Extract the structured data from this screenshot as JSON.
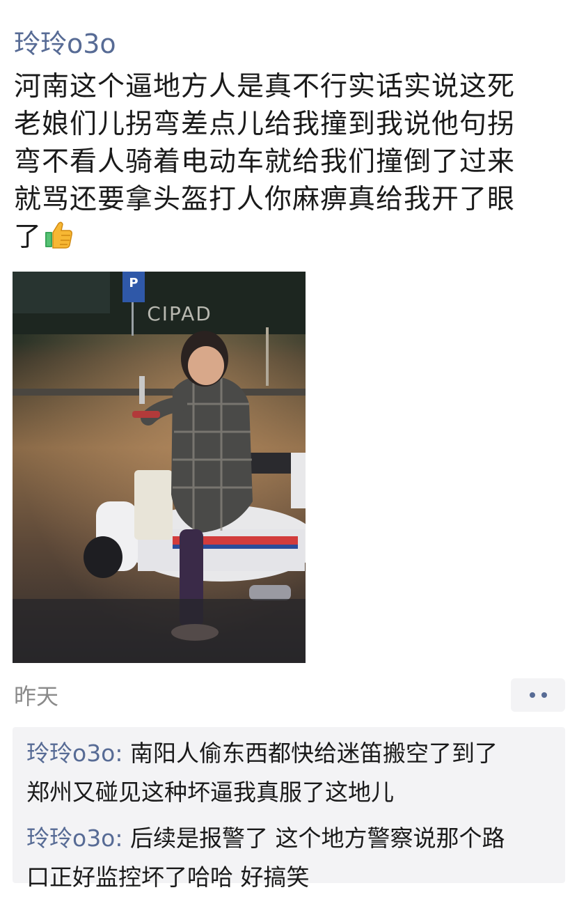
{
  "post": {
    "author": "玲玲o3o",
    "content_lines": [
      "河南这个逼地方人是真不行实话实说这死",
      "老娘们儿拐弯差点儿给我撞到我说他句拐",
      "弯不看人骑着电动车就给我们撞倒了过来",
      "就骂还要拿头盔打人你麻痹真给我开了眼",
      "了"
    ],
    "content_emoji": "thumbs-up-icon",
    "photo": {
      "description_icon": "photo-woman-on-scooter",
      "sign_text": "CIPAD"
    },
    "time": "昨天"
  },
  "comments": [
    {
      "name": "玲玲o3o",
      "sep": ": ",
      "lines": [
        "南阳人偷东西都快给迷笛搬空了到了",
        "郑州又碰见这种坏逼我真服了这地儿"
      ]
    },
    {
      "name": "玲玲o3o",
      "sep": ": ",
      "lines": [
        "后续是报警了 这个地方警察说那个路",
        "口正好监控坏了哈哈 好搞笑"
      ]
    }
  ],
  "colors": {
    "name": "#576b95",
    "text": "#1a1a1a",
    "time": "#8a8a8a",
    "panel": "#f3f3f5"
  }
}
